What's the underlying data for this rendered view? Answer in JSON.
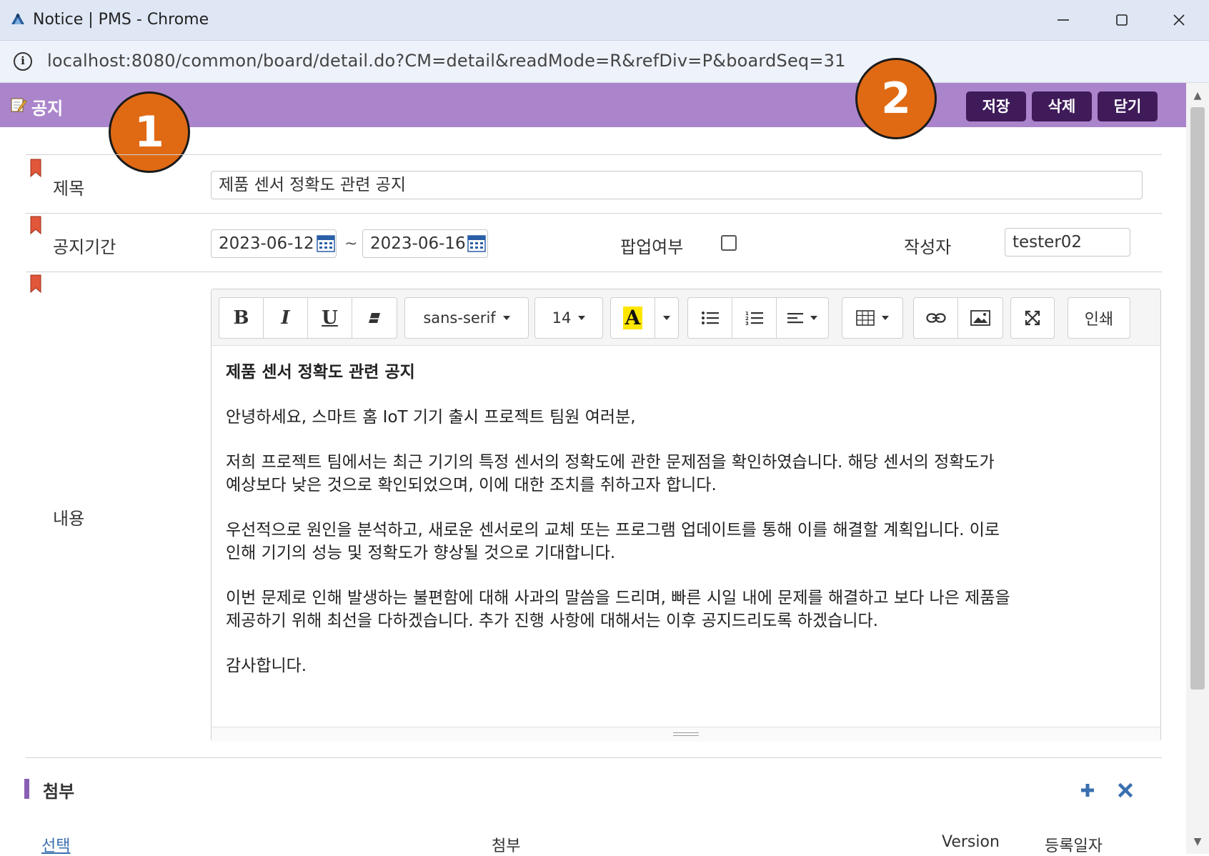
{
  "window": {
    "title": "Notice | PMS - Chrome",
    "url": "localhost:8080/common/board/detail.do?CM=detail&readMode=R&refDiv=P&boardSeq=31"
  },
  "header": {
    "title": "공지",
    "buttons": {
      "save": "저장",
      "delete": "삭제",
      "close": "닫기"
    }
  },
  "callouts": [
    "1",
    "2"
  ],
  "form": {
    "subject_label": "제목",
    "subject_value": "제품 센서 정확도 관련 공지",
    "period_label": "공지기간",
    "start_date": "2023-06-12",
    "date_separator": "~",
    "end_date": "2023-06-16",
    "popup_label": "팝업여부",
    "popup_checked": false,
    "author_label": "작성자",
    "author_value": "tester02",
    "content_label": "내용"
  },
  "editor": {
    "font_family": "sans-serif",
    "font_size": "14",
    "toolbar": {
      "bold": "B",
      "italic": "I",
      "underline": "U",
      "color": "A",
      "print": "인쇄"
    },
    "content": {
      "heading": "제품 센서 정확도 관련 공지",
      "p1": "안녕하세요, 스마트 홈 IoT 기기 출시 프로젝트 팀원 여러분,",
      "p2a": "저희 프로젝트 팀에서는 최근 기기의 특정 센서의 정확도에 관한 문제점을 확인하였습니다. 해당 센서의 정확도가",
      "p2b": "예상보다 낮은 것으로 확인되었으며, 이에 대한 조치를 취하고자 합니다.",
      "p3a": "우선적으로 원인을 분석하고, 새로운 센서로의 교체 또는 프로그램 업데이트를 통해 이를 해결할 계획입니다. 이로",
      "p3b": "인해 기기의 성능 및 정확도가 향상될 것으로 기대합니다.",
      "p4a": "이번 문제로 인해 발생하는 불편함에 대해 사과의 말씀을 드리며, 빠른 시일 내에 문제를 해결하고 보다 나은 제품을",
      "p4b": "제공하기 위해 최선을 다하겠습니다. 추가 진행 사항에 대해서는 이후 공지드리도록 하겠습니다.",
      "p5": "감사합니다."
    }
  },
  "attachments": {
    "title": "첨부",
    "columns": {
      "select": "선택",
      "file": "첨부",
      "version": "Version",
      "date": "등록일자"
    }
  },
  "colors": {
    "header_bar": "#ab85cb",
    "button": "#3f1b5a",
    "callout": "#e06a14"
  }
}
